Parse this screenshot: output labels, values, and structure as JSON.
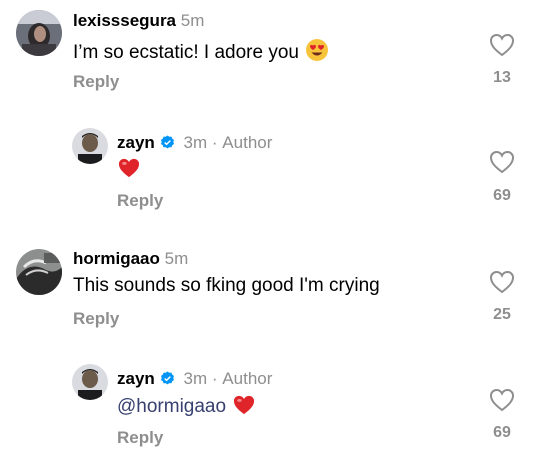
{
  "comments": [
    {
      "username": "lexisssegura",
      "time": "5m",
      "text": "I’m so ecstatic! I adore you",
      "emoji": "heart-eyes",
      "reply_label": "Reply",
      "likes": "13"
    },
    {
      "username": "zayn",
      "verified": true,
      "time": "3m",
      "author_label": "Author",
      "separator": "·",
      "emoji": "red-heart",
      "reply_label": "Reply",
      "likes": "69"
    },
    {
      "username": "hormigaao",
      "time": "5m",
      "text": "This sounds so fking good I'm crying",
      "reply_label": "Reply",
      "likes": "25"
    },
    {
      "username": "zayn",
      "verified": true,
      "time": "3m",
      "author_label": "Author",
      "separator": "·",
      "mention": "@hormigaao",
      "emoji": "red-heart",
      "reply_label": "Reply",
      "likes": "69"
    }
  ],
  "colors": {
    "muted": "#8e8e8e",
    "mention": "#37406f",
    "verified": "#0095f6",
    "heart": "#e0252a"
  }
}
